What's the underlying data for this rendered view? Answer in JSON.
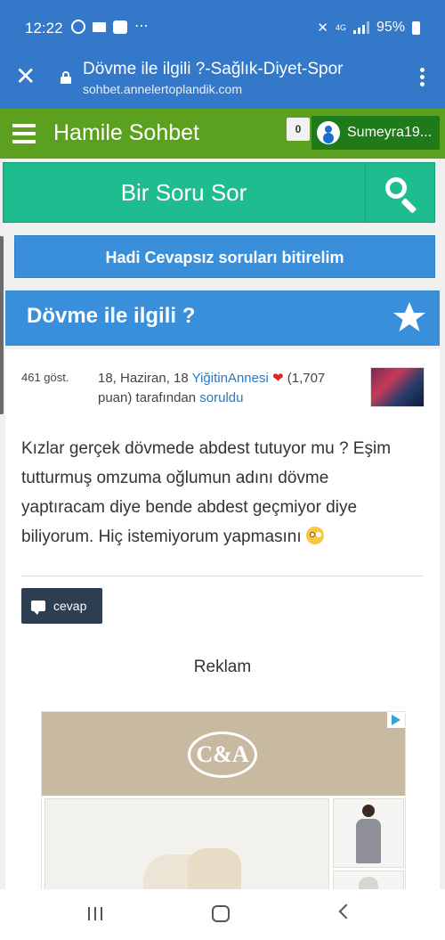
{
  "status_bar": {
    "time": "12:22",
    "network": "4G",
    "battery": "95%",
    "more": "⋯"
  },
  "browser": {
    "page_title": "Dövme ile ilgili ?-Sağlık-Diyet-Spor",
    "url": "sohbet.annelertoplandik.com"
  },
  "site_header": {
    "site_name": "Hamile Sohbet",
    "notification_count": "0",
    "user_name": "Sumeyra19..."
  },
  "ask": {
    "label": "Bir Soru Sor"
  },
  "unanswered": {
    "label": "Hadi Cevapsız soruları bitirelim"
  },
  "question": {
    "title": "Dövme ile ilgili ?",
    "views": "461 göst.",
    "date": "18, Haziran, 18",
    "author": "YiğitinAnnesi",
    "points": "(1,707 puan)",
    "by_text": "tarafından",
    "action_link": "soruldu",
    "body": "Kızlar gerçek dövmede abdest tutuyor mu ? Eşim tutturmuş omzuma oğlumun adını dövme yaptıracam diye bende abdest geçmiyor diye biliyorum. Hiç istemiyorum yapmasını",
    "answer_button": "cevap"
  },
  "ad": {
    "section_label": "Reklam",
    "brand": "C&A"
  },
  "colors": {
    "browser_bar": "#3378c9",
    "site_header": "#5ca01f",
    "ask_bar": "#1fbc8f",
    "blue_panels": "#3a8fdb",
    "answer_button": "#2c3e50"
  }
}
